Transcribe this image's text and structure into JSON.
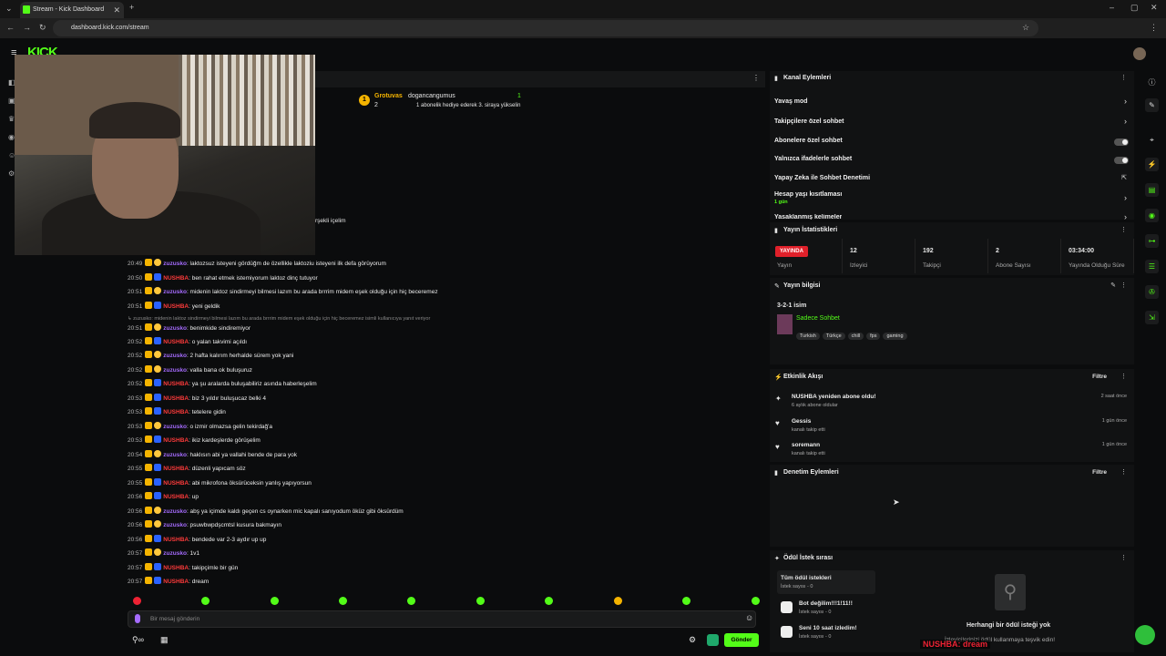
{
  "browser": {
    "tab_title": "Stream - Kick Dashboard",
    "url": "dashboard.kick.com/stream"
  },
  "app": {
    "logo": "KICK"
  },
  "pinned": {
    "rank": "1",
    "user1": "Grotuvas",
    "user1_count": "2",
    "user2": "dogancangumus",
    "user2_count": "1",
    "sub_text": "1 abonelik hediye ederek 3. siraya yükselin"
  },
  "partial_text": "rşekli içelim",
  "chat": [
    {
      "t": "20:49",
      "u": "zuzusko",
      "c": "u1",
      "m": ": laktozsuz isteyeni gördüğm de özellikle laktoziu isteyeni ilk defa görüyorum"
    },
    {
      "t": "20:50",
      "u": "NUSHBA",
      "c": "u2",
      "m": ": ben rahat etmek istemiyorum laktoz dinç tutuyor"
    },
    {
      "t": "20:51",
      "u": "zuzusko",
      "c": "u1",
      "m": ": midenin laktoz sindirmeyi bilmesi lazım bu arada brrrim midem eşek olduğu için hiç beceremez"
    },
    {
      "t": "20:51",
      "u": "NUSHBA",
      "c": "u2",
      "m": ": yeni geldik"
    },
    {
      "t": "20:51",
      "u": "zuzusko",
      "c": "u1",
      "m": ": benimkide sindiremiyor"
    },
    {
      "t": "20:52",
      "u": "NUSHBA",
      "c": "u2",
      "m": ": o yalan takvimi açıldı"
    },
    {
      "t": "20:52",
      "u": "zuzusko",
      "c": "u1",
      "m": ": 2 hafta kalırım herhalde sürem yok yani"
    },
    {
      "t": "20:52",
      "u": "zuzusko",
      "c": "u1",
      "m": ": valla bana ok buluşuruz"
    },
    {
      "t": "20:52",
      "u": "NUSHBA",
      "c": "u2",
      "m": ": ya şu aralarda buluşabiliriz asında haberleşelim"
    },
    {
      "t": "20:53",
      "u": "NUSHBA",
      "c": "u2",
      "m": ": biz 3 yıldır buluşucaz belki 4"
    },
    {
      "t": "20:53",
      "u": "NUSHBA",
      "c": "u2",
      "m": ": tetelere gidin"
    },
    {
      "t": "20:53",
      "u": "zuzusko",
      "c": "u1",
      "m": ": o izmir olmazsa gelin tekirdağ'a"
    },
    {
      "t": "20:53",
      "u": "NUSHBA",
      "c": "u2",
      "m": ": ikiz kardeşlerde görüşelim"
    },
    {
      "t": "20:54",
      "u": "zuzusko",
      "c": "u1",
      "m": ": haklısın abi ya vallahi bende de para yok"
    },
    {
      "t": "20:55",
      "u": "NUSHBA",
      "c": "u2",
      "m": ": düzenli yapıcam söz"
    },
    {
      "t": "20:55",
      "u": "NUSHBA",
      "c": "u2",
      "m": ": abi mikrofona öksürüceksin yanlış yapıyorsun"
    },
    {
      "t": "20:56",
      "u": "NUSHBA",
      "c": "u2",
      "m": ": up"
    },
    {
      "t": "20:56",
      "u": "zuzusko",
      "c": "u1",
      "m": ": abş ya içimde kaldı geçen cs oynarken mic kapalı sanıyodum öküz gibi öksürdüm"
    },
    {
      "t": "20:56",
      "u": "zuzusko",
      "c": "u1",
      "m": ": psuwbwpdşcmtsl kusura bakmayın"
    },
    {
      "t": "20:56",
      "u": "NUSHBA",
      "c": "u2",
      "m": ": bendede var 2-3 aydır up up"
    },
    {
      "t": "20:57",
      "u": "zuzusko",
      "c": "u1",
      "m": ": 1v1"
    },
    {
      "t": "20:57",
      "u": "NUSHBA",
      "c": "u2",
      "m": ": takipçimle bir gün"
    },
    {
      "t": "20:57",
      "u": "NUSHBA",
      "c": "u2",
      "m": ": dream"
    }
  ],
  "reply_note": "↳ zuzusko: midenin laktoz sindirmeyi bilmesi lazım bu arada brrrim midem eşek olduğu için hiç beceremez isimli kullanıcıya yanıt veriyor",
  "input": {
    "placeholder": "Bir mesaj gönderin",
    "send": "Gönder"
  },
  "kanal": {
    "title": "Kanal Eylemleri",
    "items": [
      "Yavaş mod",
      "Takipçilere özel sohbet",
      "Abonelere özel sohbet",
      "Yalnızca ifadelerle sohbet",
      "Yapay Zeka ile Sohbet Denetimi",
      "Hesap yaşı kısıtlaması",
      "Yasaklanmış kelimeler"
    ],
    "age_value": "1 gün"
  },
  "stats": {
    "title": "Yayın İstatistikleri",
    "live": "YAYINDA",
    "items": [
      {
        "v": "",
        "l": "Yayın"
      },
      {
        "v": "12",
        "l": "İzleyici"
      },
      {
        "v": "192",
        "l": "Takipçi"
      },
      {
        "v": "2",
        "l": "Abone Sayısı"
      },
      {
        "v": "03:34:00",
        "l": "Yayında Olduğu Süre"
      }
    ]
  },
  "info": {
    "title": "Yayın bilgisi",
    "stream_title": "3-2-1 isim",
    "category": "Sadece Sohbet",
    "tags": [
      "Turkish",
      "Türkçe",
      "chill",
      "fps",
      "gaming"
    ]
  },
  "activity": {
    "title": "Etkinlik Akışı",
    "filter": "Filtre",
    "items": [
      {
        "title": "NUSHBA yeniden abone oldu!",
        "sub": "6 aylık abone oldular",
        "time": "2 saat önce"
      },
      {
        "title": "Gessis",
        "sub": "kanalı takip etti",
        "time": "1 gün önce"
      },
      {
        "title": "soremann",
        "sub": "kanalı takip etti",
        "time": "1 gün önce"
      }
    ]
  },
  "moderation": {
    "title": "Denetim Eylemleri",
    "filter": "Filtre"
  },
  "rewards": {
    "title": "Ödül İstek sırası",
    "items": [
      {
        "name": "Tüm ödül istekleri",
        "count": "İstek sayısı - 0"
      },
      {
        "name": "Bot değilim!!!1!11!!",
        "count": "İstek sayısı - 0"
      },
      {
        "name": "Seni 10 saat izledim!",
        "count": "İstek sayısı - 0"
      }
    ],
    "empty_title": "Herhangi bir ödül isteği yok",
    "empty_sub": "İzleyicilerinizi ödül kullanmaya teşvik edin!",
    "overlay": "NUSHBA: dream"
  }
}
